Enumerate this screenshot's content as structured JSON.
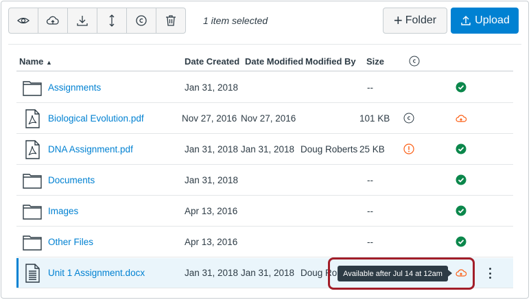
{
  "toolbar": {
    "buttons": [
      {
        "icon": "eye-icon"
      },
      {
        "icon": "cloud-publish-icon"
      },
      {
        "icon": "download-icon"
      },
      {
        "icon": "move-icon"
      },
      {
        "icon": "copyright-icon"
      },
      {
        "icon": "trash-icon"
      }
    ],
    "selection_text": "1 item selected",
    "folder_label": "Folder",
    "upload_label": "Upload"
  },
  "columns": {
    "name": "Name",
    "date_created": "Date Created",
    "date_modified": "Date Modified",
    "modified_by": "Modified By",
    "size": "Size"
  },
  "files": [
    {
      "name": "Assignments",
      "type": "folder",
      "date_created": "Jan 31, 2018",
      "date_modified": "",
      "modified_by": "",
      "size": "--",
      "usage": "",
      "status": "published"
    },
    {
      "name": "Biological Evolution.pdf",
      "type": "pdf",
      "date_created": "Nov 27, 2016",
      "date_modified": "Nov 27, 2016",
      "modified_by": "",
      "size": "101 KB",
      "usage": "copyright",
      "status": "unpublished"
    },
    {
      "name": "DNA Assignment.pdf",
      "type": "pdf",
      "date_created": "Jan 31, 2018",
      "date_modified": "Jan 31, 2018",
      "modified_by": "Doug Roberts",
      "size": "25 KB",
      "usage": "warning",
      "status": "published"
    },
    {
      "name": "Documents",
      "type": "folder",
      "date_created": "Jan 31, 2018",
      "date_modified": "",
      "modified_by": "",
      "size": "--",
      "usage": "",
      "status": "published"
    },
    {
      "name": "Images",
      "type": "folder",
      "date_created": "Apr 13, 2016",
      "date_modified": "",
      "modified_by": "",
      "size": "--",
      "usage": "",
      "status": "published"
    },
    {
      "name": "Other Files",
      "type": "folder",
      "date_created": "Apr 13, 2016",
      "date_modified": "",
      "modified_by": "",
      "size": "--",
      "usage": "",
      "status": "published"
    },
    {
      "name": "Unit 1 Assignment.docx",
      "type": "doc",
      "date_created": "Jan 31, 2018",
      "date_modified": "Jan 31, 2018",
      "modified_by": "Doug Rob",
      "size": "",
      "usage": "",
      "status": "scheduled"
    }
  ],
  "tooltip": "Available after Jul 14 at 12am",
  "colors": {
    "accent": "#0081d2",
    "published": "#0b874b",
    "unpublished": "#fc5e13",
    "highlight": "#a21d28"
  }
}
